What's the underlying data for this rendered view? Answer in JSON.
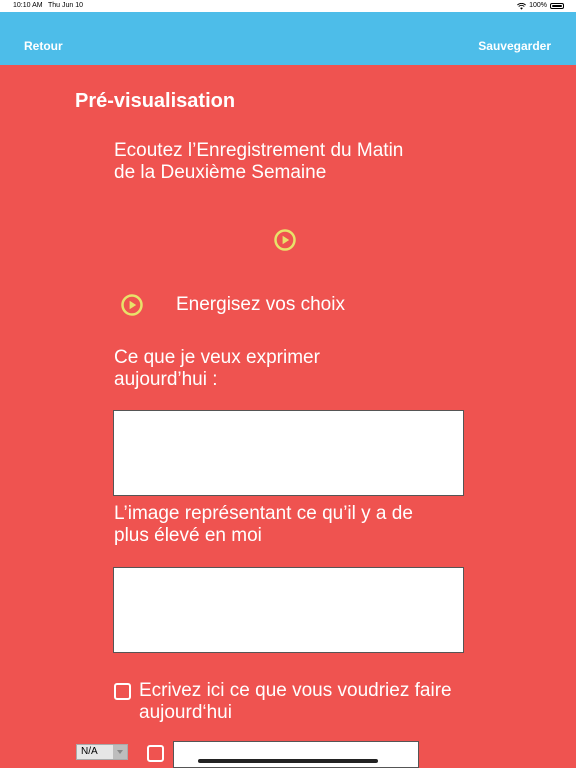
{
  "status_bar": {
    "time": "10:10 AM",
    "date": "Thu Jun 10",
    "battery": "100%"
  },
  "nav": {
    "back_label": "Retour",
    "save_label": "Sauvegarder"
  },
  "content": {
    "title": "Pré-visualisation",
    "recording_title_line1": "Ecoutez l’Enregistrement du Matin",
    "recording_title_line2": "de la Deuxième Semaine",
    "energize_label": "Energisez vos choix",
    "express_label_line1": "Ce que je veux exprimer",
    "express_label_line2": "aujourd’hui :",
    "image_label_line1": "L’image représentant ce qu’il y a de",
    "image_label_line2": "plus élevé en moi",
    "write_label_line1": "Ecrivez ici ce que vous voudriez faire",
    "write_label_line2": "aujourd‘hui",
    "na_option": "N/A"
  },
  "colors": {
    "background": "#ef5350",
    "nav_bar": "#4dbde9",
    "play_icon": "#e8e26a"
  }
}
